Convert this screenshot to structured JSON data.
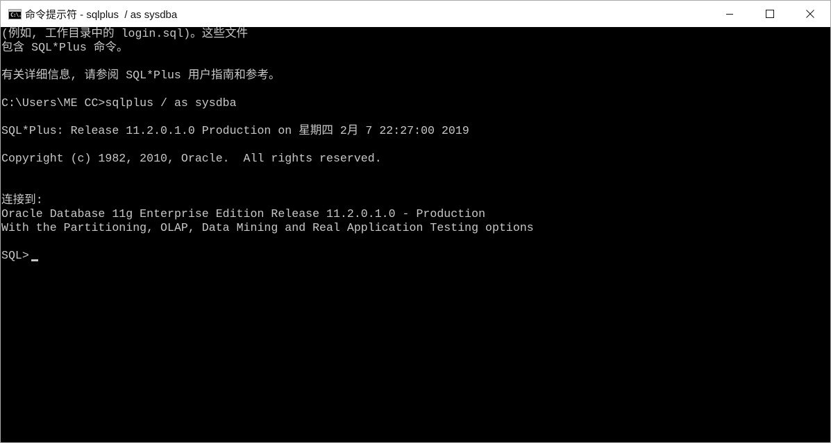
{
  "window": {
    "title": "命令提示符 - sqlplus  / as sysdba",
    "icon": "cmd-icon",
    "icon_text": "C:\\."
  },
  "controls": {
    "minimize_icon": "minimize-icon",
    "maximize_icon": "maximize-icon",
    "close_icon": "close-icon"
  },
  "console": {
    "lines": [
      "(例如, 工作目录中的 login.sql)。这些文件",
      "包含 SQL*Plus 命令。",
      "",
      "有关详细信息, 请参阅 SQL*Plus 用户指南和参考。",
      "",
      "C:\\Users\\ME CC>sqlplus / as sysdba",
      "",
      "SQL*Plus: Release 11.2.0.1.0 Production on 星期四 2月 7 22:27:00 2019",
      "",
      "Copyright (c) 1982, 2010, Oracle.  All rights reserved.",
      "",
      "",
      "连接到:",
      "Oracle Database 11g Enterprise Edition Release 11.2.0.1.0 - Production",
      "With the Partitioning, OLAP, Data Mining and Real Application Testing options",
      ""
    ],
    "prompt": "SQL>"
  }
}
